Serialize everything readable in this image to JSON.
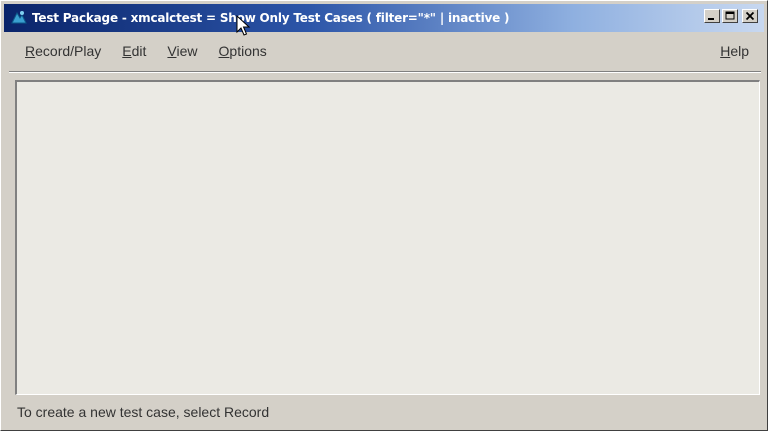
{
  "window": {
    "title": "Test Package - xmcalctest = Show Only Test Cases  ( filter=\"*\"  | inactive )",
    "buttons": {
      "minimize": "_",
      "maximize": "□",
      "close": "×"
    }
  },
  "menubar": {
    "items": [
      {
        "label": "Record/Play",
        "mnemonic": "R",
        "rest": "ecord/Play"
      },
      {
        "label": "Edit",
        "mnemonic": "E",
        "rest": "dit"
      },
      {
        "label": "View",
        "mnemonic": "V",
        "rest": "iew"
      },
      {
        "label": "Options",
        "mnemonic": "O",
        "rest": "ptions"
      }
    ],
    "help": {
      "label": "Help",
      "mnemonic": "H",
      "rest": "elp"
    }
  },
  "statusbar": {
    "text": "To create a new test case, select Record"
  },
  "colors": {
    "titlebar_start": "#0a246a",
    "titlebar_end": "#c8d8f0",
    "window_bg": "#d4d0c8",
    "content_bg": "#ebeae4"
  },
  "icons": {
    "app": "app-icon",
    "cursor": "mouse-cursor-icon"
  }
}
